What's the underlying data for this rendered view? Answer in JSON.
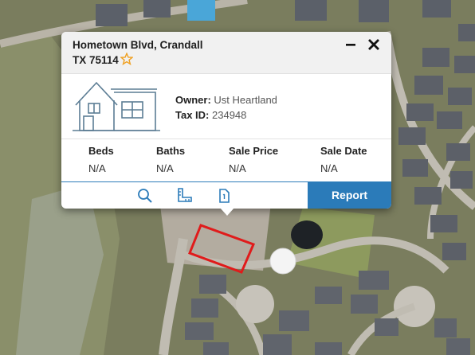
{
  "popup": {
    "address_line1": "Hometown Blvd, Crandall",
    "address_line2": "TX 75114",
    "owner_label": "Owner:",
    "owner_value": "Ust Heartland",
    "taxid_label": "Tax ID:",
    "taxid_value": "234948",
    "stats": [
      {
        "label": "Beds",
        "value": "N/A"
      },
      {
        "label": "Baths",
        "value": "N/A"
      },
      {
        "label": "Sale Price",
        "value": "N/A"
      },
      {
        "label": "Sale Date",
        "value": "N/A"
      }
    ],
    "report_label": "Report",
    "tools": [
      "search-icon",
      "ruler-icon",
      "document-icon"
    ],
    "icons": {
      "favorite": "star-icon",
      "minimize": "minimize-icon",
      "close": "close-icon"
    }
  },
  "colors": {
    "accent": "#2b7bb9",
    "star": "#f0a020",
    "parcel_outline": "#e01b1b"
  }
}
